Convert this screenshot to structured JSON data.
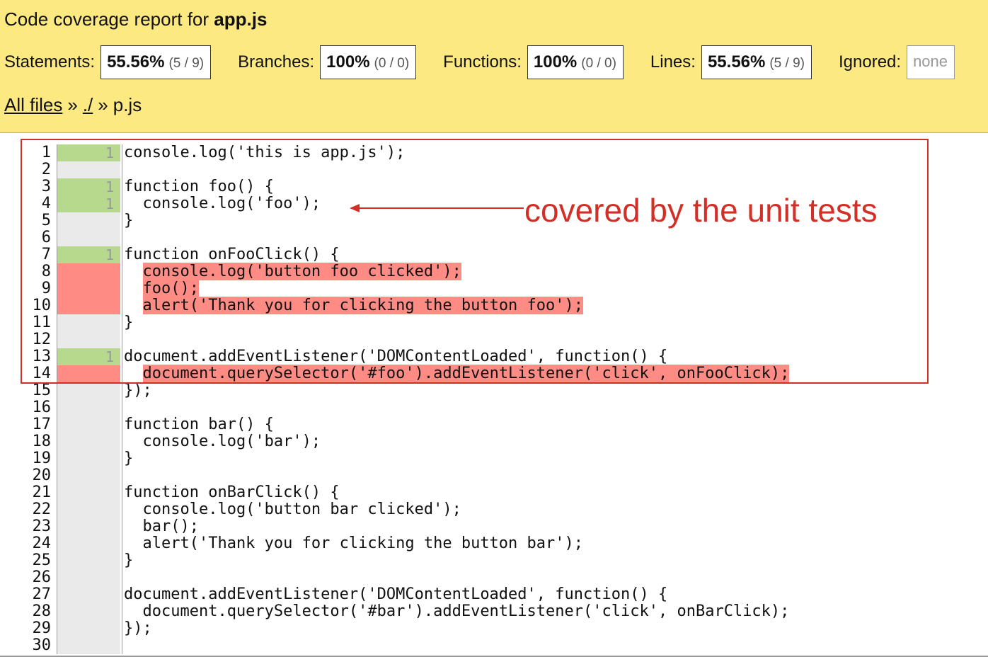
{
  "header": {
    "title_prefix": "Code coverage report for ",
    "title_file": "app.js",
    "stats": [
      {
        "label": "Statements:",
        "pct": "55.56%",
        "frac": "(5 / 9)"
      },
      {
        "label": "Branches:",
        "pct": "100%",
        "frac": "(0 / 0)"
      },
      {
        "label": "Functions:",
        "pct": "100%",
        "frac": "(0 / 0)"
      },
      {
        "label": "Lines:",
        "pct": "55.56%",
        "frac": "(5 / 9)"
      }
    ],
    "ignored_label": "Ignored:",
    "ignored_value": "none",
    "breadcrumb": {
      "all_files": "All files",
      "sep": "»",
      "dir": "./",
      "file": "p.js"
    }
  },
  "annotation": "covered by the unit tests",
  "colors": {
    "covered": "#b6d98e",
    "uncovered": "#fe8c84",
    "header_bg": "#fde982",
    "annotation": "#d22f27"
  },
  "code": [
    {
      "n": "1",
      "status": "hit",
      "count": "1",
      "text": "console.log('this is app.js');",
      "hl": false
    },
    {
      "n": "2",
      "status": "none",
      "count": "",
      "text": "",
      "hl": false
    },
    {
      "n": "3",
      "status": "hit",
      "count": "1",
      "text": "function foo() {",
      "hl": false
    },
    {
      "n": "4",
      "status": "hit",
      "count": "1",
      "text": "  console.log('foo');",
      "hl": false
    },
    {
      "n": "5",
      "status": "none",
      "count": "",
      "text": "}",
      "hl": false
    },
    {
      "n": "6",
      "status": "none",
      "count": "",
      "text": "",
      "hl": false
    },
    {
      "n": "7",
      "status": "hit",
      "count": "1",
      "text": "function onFooClick() {",
      "hl": false
    },
    {
      "n": "8",
      "status": "miss",
      "count": "",
      "text": "  console.log('button foo clicked');",
      "hl": true
    },
    {
      "n": "9",
      "status": "miss",
      "count": "",
      "text": "  foo();",
      "hl": true
    },
    {
      "n": "10",
      "status": "miss",
      "count": "",
      "text": "  alert('Thank you for clicking the button foo');",
      "hl": true
    },
    {
      "n": "11",
      "status": "none",
      "count": "",
      "text": "}",
      "hl": false
    },
    {
      "n": "12",
      "status": "none",
      "count": "",
      "text": "",
      "hl": false
    },
    {
      "n": "13",
      "status": "hit",
      "count": "1",
      "text": "document.addEventListener('DOMContentLoaded', function() {",
      "hl": false
    },
    {
      "n": "14",
      "status": "miss",
      "count": "",
      "text": "  document.querySelector('#foo').addEventListener('click', onFooClick);",
      "hl": true
    },
    {
      "n": "15",
      "status": "none",
      "count": "",
      "text": "});",
      "hl": false
    },
    {
      "n": "16",
      "status": "none",
      "count": "",
      "text": "",
      "hl": false
    },
    {
      "n": "17",
      "status": "none",
      "count": "",
      "text": "function bar() {",
      "hl": false
    },
    {
      "n": "18",
      "status": "none",
      "count": "",
      "text": "  console.log('bar');",
      "hl": false
    },
    {
      "n": "19",
      "status": "none",
      "count": "",
      "text": "}",
      "hl": false
    },
    {
      "n": "20",
      "status": "none",
      "count": "",
      "text": "",
      "hl": false
    },
    {
      "n": "21",
      "status": "none",
      "count": "",
      "text": "function onBarClick() {",
      "hl": false
    },
    {
      "n": "22",
      "status": "none",
      "count": "",
      "text": "  console.log('button bar clicked');",
      "hl": false
    },
    {
      "n": "23",
      "status": "none",
      "count": "",
      "text": "  bar();",
      "hl": false
    },
    {
      "n": "24",
      "status": "none",
      "count": "",
      "text": "  alert('Thank you for clicking the button bar');",
      "hl": false
    },
    {
      "n": "25",
      "status": "none",
      "count": "",
      "text": "}",
      "hl": false
    },
    {
      "n": "26",
      "status": "none",
      "count": "",
      "text": "",
      "hl": false
    },
    {
      "n": "27",
      "status": "none",
      "count": "",
      "text": "document.addEventListener('DOMContentLoaded', function() {",
      "hl": false
    },
    {
      "n": "28",
      "status": "none",
      "count": "",
      "text": "  document.querySelector('#bar').addEventListener('click', onBarClick);",
      "hl": false
    },
    {
      "n": "29",
      "status": "none",
      "count": "",
      "text": "});",
      "hl": false
    },
    {
      "n": "30",
      "status": "none",
      "count": "",
      "text": "",
      "hl": false
    }
  ]
}
